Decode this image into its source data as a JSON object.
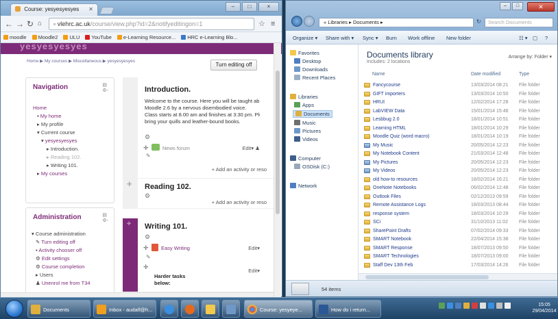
{
  "chrome": {
    "tab_title": "Course: yesyesyesyes",
    "window_controls": [
      "–",
      "□",
      "×"
    ],
    "url_host": "vlehrc.ac.uk",
    "url_path": "/course/view.php?id=2&notifyeditingon=1",
    "bookmarks": [
      {
        "label": "moodle",
        "color": "#f39c12"
      },
      {
        "label": "Moodle2",
        "color": "#f39c12"
      },
      {
        "label": "ULU",
        "color": "#f39c12"
      },
      {
        "label": "YouTube",
        "color": "#d81e1e"
      },
      {
        "label": "e-Learning Resource...",
        "color": "#f39c12"
      },
      {
        "label": "HRC e-Learning Blo...",
        "color": "#3a78c8"
      }
    ]
  },
  "moodle": {
    "header_text": "yesyesyesyes",
    "breadcrumb": "Home ▶ My courses ▶ Miscellaneous ▶ yesyesyesyes",
    "turn_editing": "Turn editing off",
    "navigation": {
      "title": "Navigation",
      "home": "Home",
      "my_home": "My home",
      "my_profile": "My profile",
      "current_course": "Current course",
      "course": "yesyesyesyes",
      "intro": "Introduction.",
      "reading": "Reading 102.",
      "writing": "Writing 101.",
      "my_courses": "My courses"
    },
    "administration": {
      "title": "Administration",
      "course_admin": "Course administration",
      "turn_off": "Turn editing off",
      "activity_chooser": "Activity chooser off",
      "edit_settings": "Edit settings",
      "completion": "Course completion",
      "users": "Users",
      "unenrol": "Unenrol me from T34"
    },
    "sections": [
      {
        "title": "Introduction.",
        "lines": [
          "Welcome to the course. Here you will be taught ab",
          "Moodle 2.6 by a nervous disembodied voice.",
          "Class starts at 8.00 am and finishes at 3:30 pm. Ple",
          "bring your quills and leather-bound books."
        ],
        "activity": "News forum",
        "edit": "Edit",
        "add": "+ Add an activity or reso"
      },
      {
        "title": "Reading 102.",
        "add": "+ Add an activity or reso"
      },
      {
        "title": "Writing 101.",
        "activity": "Easy Writing",
        "edit": "Edit",
        "sub": "Harder tasks below:"
      }
    ]
  },
  "explorer": {
    "breadcrumb": "« Libraries ▸ Documents ▸",
    "search_placeholder": "Search Documents",
    "toolbar": [
      "Organize ▾",
      "Share with ▾",
      "Sync ▾",
      "Burn",
      "Work offline",
      "New folder"
    ],
    "nav": {
      "favorites": "Favorites",
      "desktop": "Desktop",
      "downloads": "Downloads",
      "recent": "Recent Places",
      "libraries": "Libraries",
      "apps": "Apps",
      "documents": "Documents",
      "music": "Music",
      "pictures": "Pictures",
      "videos": "Videos",
      "computer": "Computer",
      "osdisk": "OSDisk (C:)",
      "network": "Network"
    },
    "library_title": "Documents library",
    "library_sub": "Includes: 2 locations",
    "arrange": "Arrange by:  Folder ▾",
    "columns": [
      "Name",
      "Date modified",
      "Type"
    ],
    "files": [
      {
        "name": "Fancycourse",
        "date": "13/03/2014 08:21",
        "type": "File folder",
        "lib": false
      },
      {
        "name": "GIFT importers",
        "date": "13/03/2014 10:50",
        "type": "File folder",
        "lib": false
      },
      {
        "name": "HRUI",
        "date": "12/02/2014 17:28",
        "type": "File folder",
        "lib": false
      },
      {
        "name": "LabVIEW Data",
        "date": "15/01/2014 15:48",
        "type": "File folder",
        "lib": false
      },
      {
        "name": "Lesbbug 2.0",
        "date": "18/01/2014 10:51",
        "type": "File folder",
        "lib": false
      },
      {
        "name": "Learning HTML",
        "date": "18/01/2014 10:29",
        "type": "File folder",
        "lib": false
      },
      {
        "name": "Moodle Quiz (word macro)",
        "date": "18/01/2014 10:19",
        "type": "File folder",
        "lib": false
      },
      {
        "name": "My Music",
        "date": "20/05/2014 12:23",
        "type": "File folder",
        "lib": true
      },
      {
        "name": "My Notebook Content",
        "date": "21/03/2014 12:48",
        "type": "File folder",
        "lib": false
      },
      {
        "name": "My Pictures",
        "date": "20/05/2014 12:23",
        "type": "File folder",
        "lib": true
      },
      {
        "name": "My Videos",
        "date": "20/05/2014 12:23",
        "type": "File folder",
        "lib": true
      },
      {
        "name": "old how-to resources",
        "date": "18/02/2014 16:21",
        "type": "File folder",
        "lib": false
      },
      {
        "name": "OneNote Notebooks",
        "date": "06/02/2014 12:48",
        "type": "File folder",
        "lib": false
      },
      {
        "name": "Outlook Files",
        "date": "02/12/2013 09:59",
        "type": "File folder",
        "lib": false
      },
      {
        "name": "Remote Assistance Logs",
        "date": "18/03/2013 08:44",
        "type": "File folder",
        "lib": false
      },
      {
        "name": "response system",
        "date": "18/03/2014 10:29",
        "type": "File folder",
        "lib": false
      },
      {
        "name": "SCi",
        "date": "31/10/2013 11:02",
        "type": "File folder",
        "lib": false
      },
      {
        "name": "SharePoint Drafts",
        "date": "07/02/2014 09:33",
        "type": "File folder",
        "lib": false
      },
      {
        "name": "SMART Notebook",
        "date": "22/04/2014 15:38",
        "type": "File folder",
        "lib": false
      },
      {
        "name": "SMART Response",
        "date": "18/07/2013 09:50",
        "type": "File folder",
        "lib": false
      },
      {
        "name": "SMART Technologies",
        "date": "18/07/2013 09:00",
        "type": "File folder",
        "lib": false
      },
      {
        "name": "Staff Dev 13th Feb",
        "date": "17/03/2014 14:26",
        "type": "File folder",
        "lib": false
      }
    ],
    "status": "54 items"
  },
  "taskbar": {
    "documents": "Documents",
    "inbox": "Inbox - audalf@h...",
    "chrome_course": "Course: yesyeye...",
    "word": "How do i return...",
    "clock_time": "15:05",
    "clock_date": "29/04/2014"
  },
  "colors": {
    "moodle_accent": "#7d2b78",
    "explorer_link": "#1e3a8a"
  }
}
